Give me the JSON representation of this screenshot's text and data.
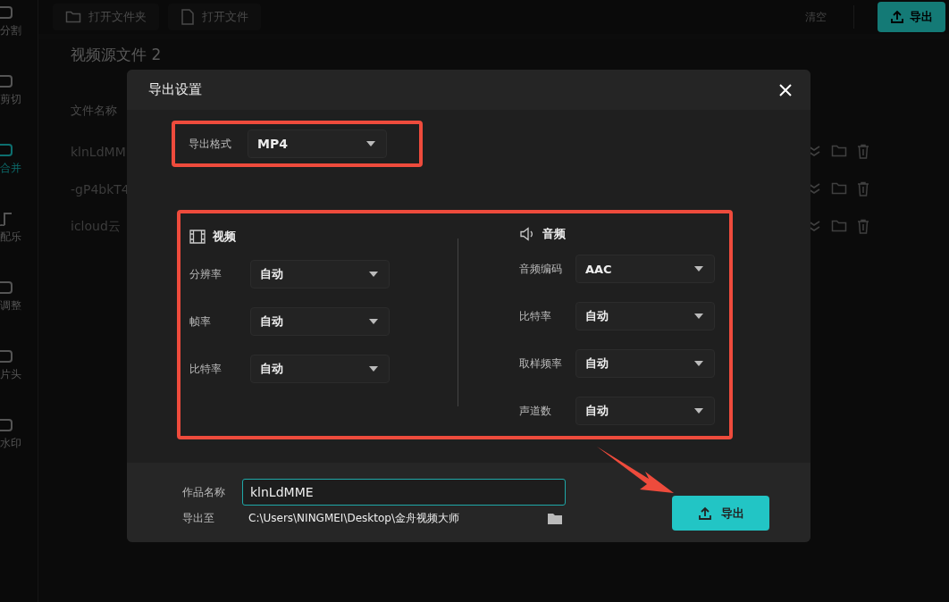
{
  "sidebar": {
    "items": [
      {
        "label": "分割",
        "selected": false
      },
      {
        "label": "剪切",
        "selected": false
      },
      {
        "label": "合并",
        "selected": true
      },
      {
        "label": "配乐",
        "selected": false
      },
      {
        "label": "调整",
        "selected": false
      },
      {
        "label": "片头",
        "selected": false
      },
      {
        "label": "水印",
        "selected": false
      }
    ]
  },
  "toolbar": {
    "buttons": [
      {
        "label": "打开文件夹"
      },
      {
        "label": "打开文件"
      }
    ],
    "clear": "清空",
    "export": "导出"
  },
  "file_list": {
    "title": "视频源文件 2",
    "column": "文件名称",
    "rows": [
      "klnLdMM",
      "-gP4bkT4",
      "icloud云"
    ]
  },
  "dialog": {
    "title": "导出设置",
    "format": {
      "label": "导出格式",
      "value": "MP4"
    },
    "video": {
      "title": "视频",
      "fields": [
        {
          "label": "分辨率",
          "value": "自动"
        },
        {
          "label": "帧率",
          "value": "自动"
        },
        {
          "label": "比特率",
          "value": "自动"
        }
      ]
    },
    "audio": {
      "title": "音频",
      "fields": [
        {
          "label": "音频编码",
          "value": "AAC"
        },
        {
          "label": "比特率",
          "value": "自动"
        },
        {
          "label": "取样频率",
          "value": "自动"
        },
        {
          "label": "声道数",
          "value": "自动"
        }
      ]
    },
    "work_name": {
      "label": "作品名称",
      "value": "klnLdMME"
    },
    "destination": {
      "label": "导出至",
      "path": "C:\\Users\\NINGMEI\\Desktop\\金舟视频大师"
    },
    "export_button": "导出"
  }
}
